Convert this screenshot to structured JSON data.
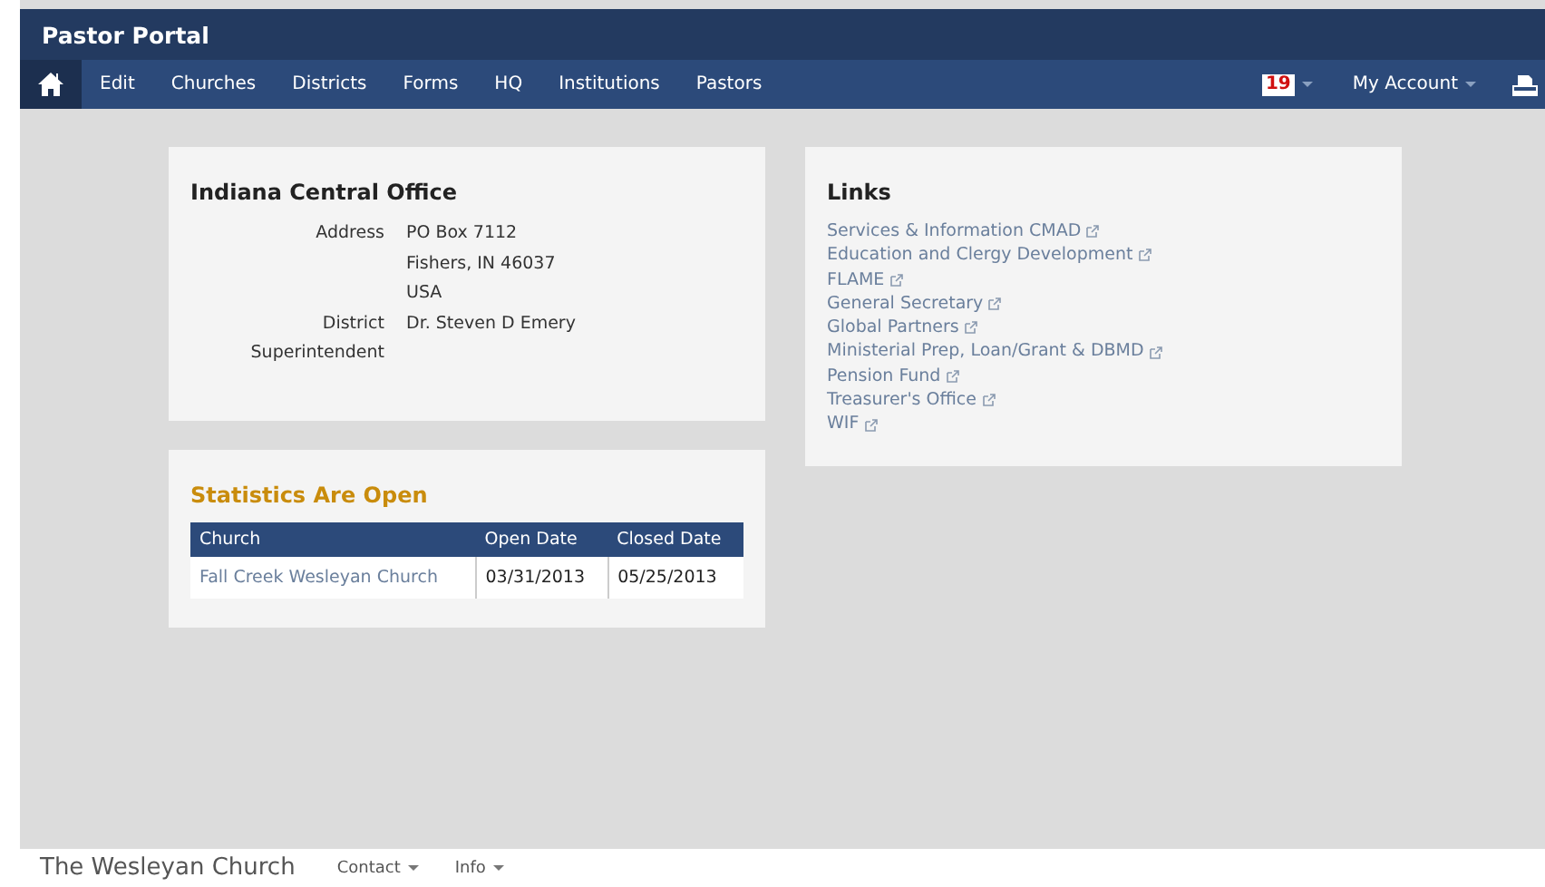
{
  "header": {
    "title": "Pastor Portal"
  },
  "nav": {
    "items": [
      {
        "kind": "home",
        "selected": true
      },
      {
        "label": "Edit",
        "selected": false
      },
      {
        "label": "Churches",
        "selected": false
      },
      {
        "label": "Districts",
        "selected": false
      },
      {
        "label": "Forms",
        "selected": false
      },
      {
        "label": "HQ",
        "selected": false
      },
      {
        "label": "Institutions",
        "selected": false
      },
      {
        "label": "Pastors",
        "selected": false
      }
    ],
    "notifications": "19",
    "account": "My Account"
  },
  "office": {
    "title": "Indiana Central Office",
    "fields": [
      {
        "label": "Address",
        "lines": [
          "PO Box 7112",
          "Fishers, IN 46037",
          "USA"
        ]
      },
      {
        "label": "District Superintendent",
        "lines": [
          "Dr. Steven D Emery"
        ]
      }
    ]
  },
  "statistics": {
    "title": "Statistics Are Open",
    "columns": [
      "Church",
      "Open Date",
      "Closed Date"
    ],
    "rows": [
      [
        "Fall Creek Wesleyan Church",
        "03/31/2013",
        "05/25/2013"
      ]
    ]
  },
  "links": {
    "title": "Links",
    "items": [
      "Services & Information CMAD",
      "Education and Clergy Development",
      "FLAME",
      "General Secretary",
      "Global Partners",
      "Ministerial Prep, Loan/Grant & DBMD",
      "Pension Fund",
      "Treasurer's Office",
      "WIF"
    ]
  },
  "footer": {
    "brand": "The Wesleyan Church",
    "menus": [
      "Contact",
      "Info"
    ]
  }
}
